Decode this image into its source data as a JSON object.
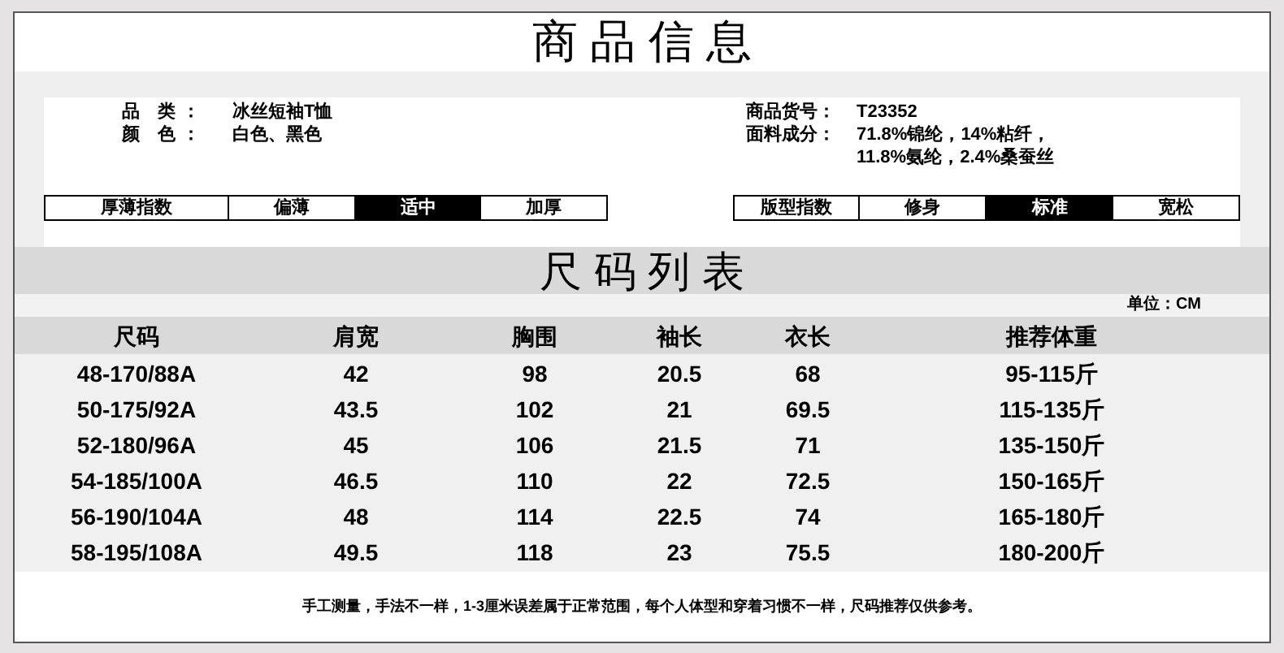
{
  "title": "商 品 信 息",
  "info_left": [
    {
      "label": "品 类：",
      "lines": [
        "冰丝短袖T恤"
      ]
    },
    {
      "label": "颜 色：",
      "lines": [
        "白色、黑色"
      ]
    }
  ],
  "info_right": [
    {
      "label": "商品货号：",
      "lines": [
        "T23352"
      ]
    },
    {
      "label": "面料成分：",
      "lines": [
        "71.8%锦纶，14%粘纤，",
        "11.8%氨纶，2.4%桑蚕丝"
      ]
    }
  ],
  "thickness_scale": {
    "label": "厚薄指数",
    "options": [
      {
        "label": "偏薄",
        "selected": false
      },
      {
        "label": "适中",
        "selected": true
      },
      {
        "label": "加厚",
        "selected": false
      }
    ]
  },
  "fit_scale": {
    "label": "版型指数",
    "options": [
      {
        "label": "修身",
        "selected": false
      },
      {
        "label": "标准",
        "selected": true
      },
      {
        "label": "宽松",
        "selected": false
      }
    ]
  },
  "size_title": "尺 码 列 表",
  "unit": "单位：CM",
  "table": {
    "columns": [
      "尺码",
      "肩宽",
      "胸围",
      "袖长",
      "衣长",
      "推荐体重"
    ],
    "rows": [
      [
        "48-170/88A",
        "42",
        "98",
        "20.5",
        "68",
        "95-115斤"
      ],
      [
        "50-175/92A",
        "43.5",
        "102",
        "21",
        "69.5",
        "115-135斤"
      ],
      [
        "52-180/96A",
        "45",
        "106",
        "21.5",
        "71",
        "135-150斤"
      ],
      [
        "54-185/100A",
        "46.5",
        "110",
        "22",
        "72.5",
        "150-165斤"
      ],
      [
        "56-190/104A",
        "48",
        "114",
        "22.5",
        "74",
        "165-180斤"
      ],
      [
        "58-195/108A",
        "49.5",
        "118",
        "23",
        "75.5",
        "180-200斤"
      ]
    ]
  },
  "footnote": "手工测量，手法不一样，1-3厘米误差属于正常范围，每个人体型和穿着习惯不一样，尺码推荐仅供参考。"
}
